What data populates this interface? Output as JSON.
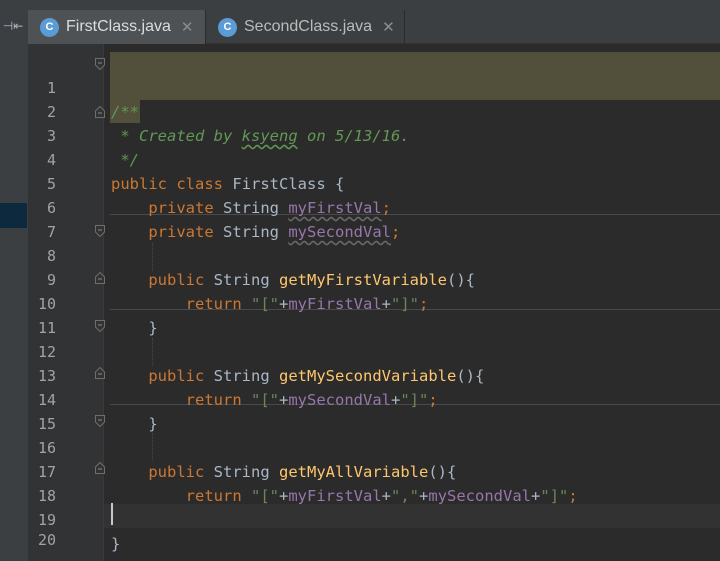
{
  "left_panel": {
    "collapse_label": "⊣⇤"
  },
  "tabs": [
    {
      "label": "FirstClass.java",
      "icon_letter": "C",
      "active": true
    },
    {
      "label": "SecondClass.java",
      "icon_letter": "C",
      "active": false
    }
  ],
  "editor": {
    "line_numbers": [
      "1",
      "2",
      "3",
      "4",
      "5",
      "6",
      "7",
      "8",
      "9",
      "10",
      "11",
      "12",
      "13",
      "14",
      "15",
      "16",
      "17",
      "18",
      "19",
      "20"
    ],
    "lines": {
      "l1": "/**",
      "l2_pre": " * Created by ",
      "l2_user": "ksyeng",
      "l2_post": " on 5/13/16.",
      "l3": " */",
      "kw_public": "public",
      "kw_class": "class",
      "class_name": "FirstClass",
      "brace_open": " {",
      "kw_private": "private",
      "type_string": "String",
      "field1": "myFirstVal",
      "field2": "mySecondVal",
      "semicolon": ";",
      "method1": "getMyFirstVariable",
      "method2": "getMySecondVariable",
      "method3": "getMyAllVariable",
      "parens_open": "(){",
      "kw_return": "return",
      "str_open": "\"[\"",
      "plus": "+",
      "str_close": "\"]\"",
      "str_comma": "\",\"",
      "brace_close": "}"
    }
  },
  "icons": {
    "tab_icon": "java-class-icon",
    "close": "close-icon",
    "fold": "fold-marker-icon"
  },
  "colors": {
    "keyword": "#cc7832",
    "comment": "#629755",
    "string": "#6a8759",
    "field": "#9876aa",
    "method": "#ffc66d",
    "text": "#a9b7c6",
    "background": "#2b2b2b"
  }
}
